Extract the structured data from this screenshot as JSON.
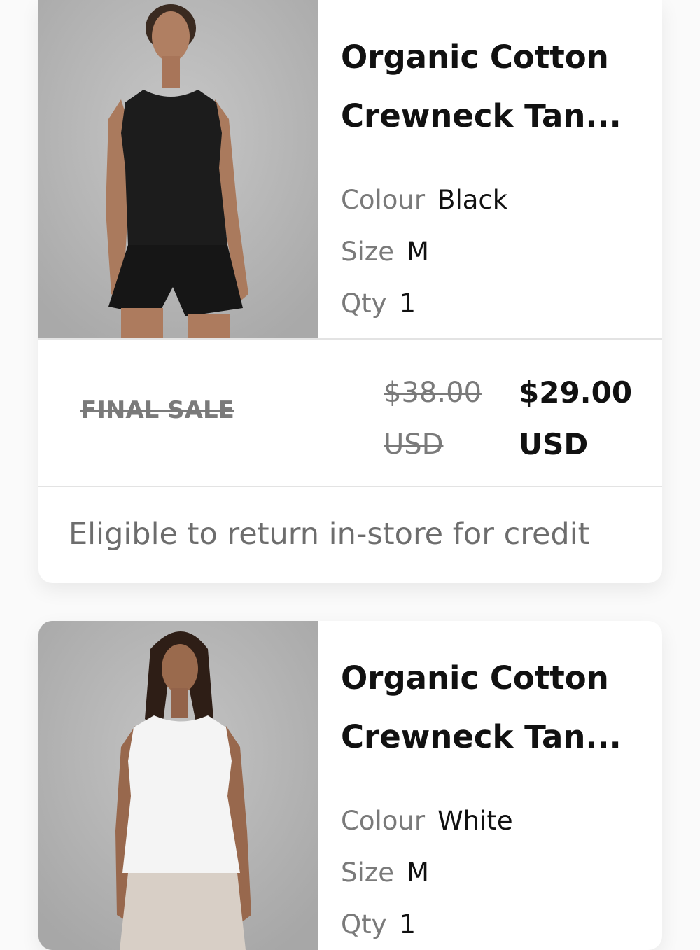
{
  "items": [
    {
      "title": "Organic Cotton Crewneck Tan...",
      "colour_label": "Colour",
      "colour_value": "Black",
      "size_label": "Size",
      "size_value": "M",
      "qty_label": "Qty",
      "qty_value": "1",
      "sale_tag": "FINAL SALE",
      "original_price": "$38.00 USD",
      "sale_price": "$29.00 USD",
      "return_note": "Eligible to return in-store for credit",
      "photo_icon": "model-photo-black-tank"
    },
    {
      "title": "Organic Cotton Crewneck Tan...",
      "colour_label": "Colour",
      "colour_value": "White",
      "size_label": "Size",
      "size_value": "M",
      "qty_label": "Qty",
      "qty_value": "1",
      "photo_icon": "model-photo-white-tank"
    }
  ],
  "colors": {
    "photo_background": "#bdbdbd",
    "tank_black": "#1c1c1c",
    "tank_white": "#f4f4f4",
    "muted_text": "#7a7a7a"
  }
}
